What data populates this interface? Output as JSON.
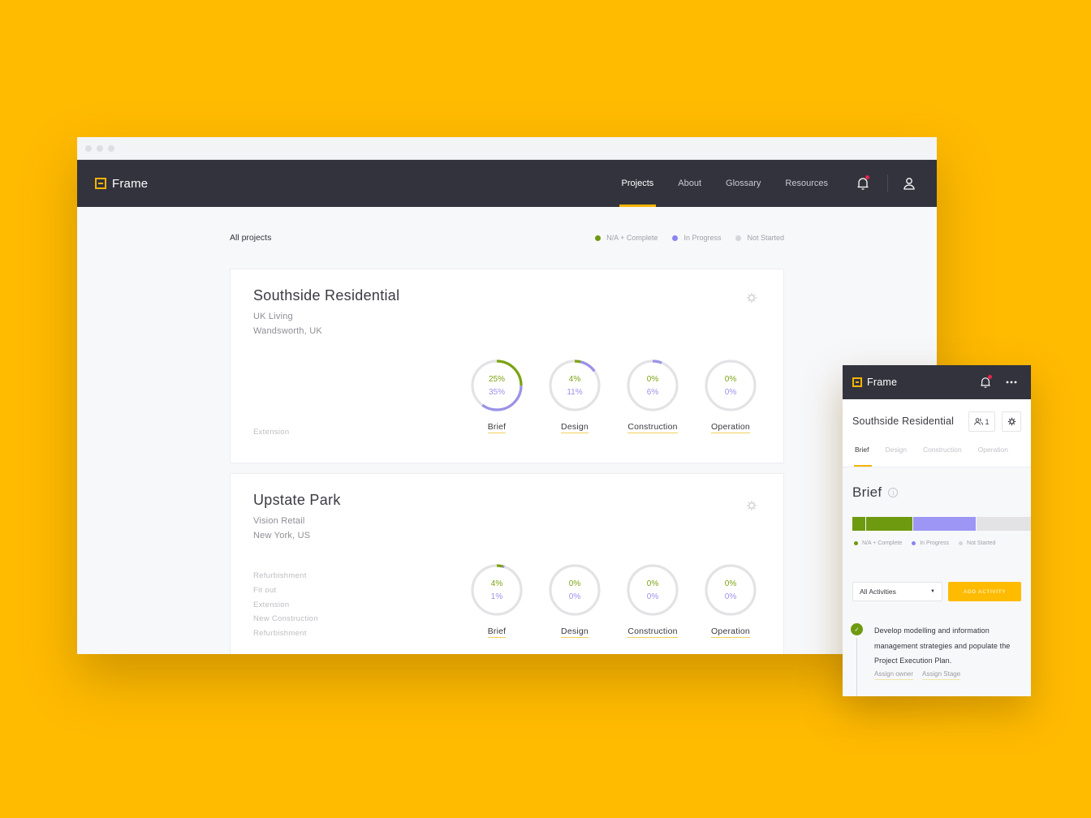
{
  "browser": {
    "app_name": "Frame",
    "nav": [
      {
        "label": "Projects",
        "active": true
      },
      {
        "label": "About",
        "active": false
      },
      {
        "label": "Glossary",
        "active": false
      },
      {
        "label": "Resources",
        "active": false
      }
    ],
    "notifications_unread": true
  },
  "page": {
    "title": "All projects",
    "legend": [
      {
        "label": "N/A + Complete",
        "color": "#6E9A10"
      },
      {
        "label": "In Progress",
        "color": "#8B84EE"
      },
      {
        "label": "Not Started",
        "color": "#D5D5DA"
      }
    ]
  },
  "colors": {
    "complete": "#7BA312",
    "in_progress": "#9A92E8",
    "not_started": "#E3E3E6",
    "accent": "#FFBB00",
    "topbar": "#33333D"
  },
  "projects": [
    {
      "name": "Southside Residential",
      "client": "UK Living",
      "location": "Wandsworth, UK",
      "types": [
        "Extension"
      ],
      "stages": [
        {
          "label": "Brief",
          "complete_pct": 25,
          "in_progress_pct": 35
        },
        {
          "label": "Design",
          "complete_pct": 4,
          "in_progress_pct": 11
        },
        {
          "label": "Construction",
          "complete_pct": 0,
          "in_progress_pct": 6
        },
        {
          "label": "Operation",
          "complete_pct": 0,
          "in_progress_pct": 0
        }
      ]
    },
    {
      "name": "Upstate Park",
      "client": "Vision Retail",
      "location": "New York, US",
      "types": [
        "Refurbishment",
        "Fit out",
        "Extension",
        "New Construction",
        "Refurbishment"
      ],
      "stages": [
        {
          "label": "Brief",
          "complete_pct": 4,
          "in_progress_pct": 1
        },
        {
          "label": "Design",
          "complete_pct": 0,
          "in_progress_pct": 0
        },
        {
          "label": "Construction",
          "complete_pct": 0,
          "in_progress_pct": 0
        },
        {
          "label": "Operation",
          "complete_pct": 0,
          "in_progress_pct": 0
        }
      ]
    }
  ],
  "mobile": {
    "app_name": "Frame",
    "project_name": "Southside Residential",
    "team_count": "1",
    "tabs": [
      {
        "label": "Brief",
        "active": true
      },
      {
        "label": "Design",
        "active": false
      },
      {
        "label": "Construction",
        "active": false
      },
      {
        "label": "Operation",
        "active": false
      }
    ],
    "stage_title": "Brief",
    "info_glyph": "i",
    "progress": {
      "complete_segments_pct": [
        8,
        28
      ],
      "in_progress_pct": 37,
      "not_started_pct": 35
    },
    "legend": [
      {
        "label": "N/A + Complete",
        "color": "#6E9A10"
      },
      {
        "label": "In Progress",
        "color": "#8B84EE"
      },
      {
        "label": "Not Started",
        "color": "#D5D5DA"
      }
    ],
    "filter_value": "All Activities",
    "add_button": "ADD ACTIVITY",
    "activity": {
      "text": "Develop modelling and information management strategies and populate the Project Execution Plan.",
      "completed": true,
      "links": [
        "Assign owner",
        "Assign Stage"
      ]
    }
  }
}
